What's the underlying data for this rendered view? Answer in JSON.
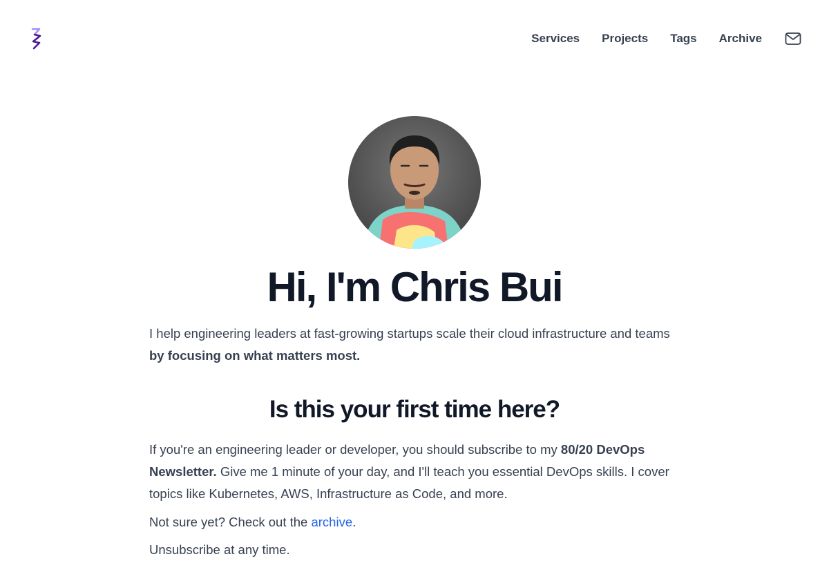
{
  "nav": {
    "items": [
      "Services",
      "Projects",
      "Tags",
      "Archive"
    ],
    "mail_icon": "mail-icon"
  },
  "logo": {
    "icon": "cb-logo-icon",
    "colors": [
      "#a78bfa",
      "#4c1d95"
    ]
  },
  "hero": {
    "title": "Hi, I'm Chris Bui",
    "tagline_start": "I help engineering leaders at fast-growing startups scale their cloud infrastructure and teams ",
    "tagline_bold": "by focusing on what matters most."
  },
  "section": {
    "title": "Is this your first time here?",
    "para1_start": "If you're an engineering leader or developer, you should subscribe to my ",
    "para1_bold": "80/20 DevOps Newsletter.",
    "para1_end": " Give me 1 minute of your day, and I'll teach you essential DevOps skills. I cover topics like Kubernetes, AWS, Infrastructure as Code, and more.",
    "para2_start": "Not sure yet? Check out the ",
    "para2_link": "archive",
    "para2_end": ".",
    "para3": "Unsubscribe at any time."
  },
  "colors": {
    "text": "#374151",
    "heading": "#111827",
    "link": "#2563eb"
  }
}
